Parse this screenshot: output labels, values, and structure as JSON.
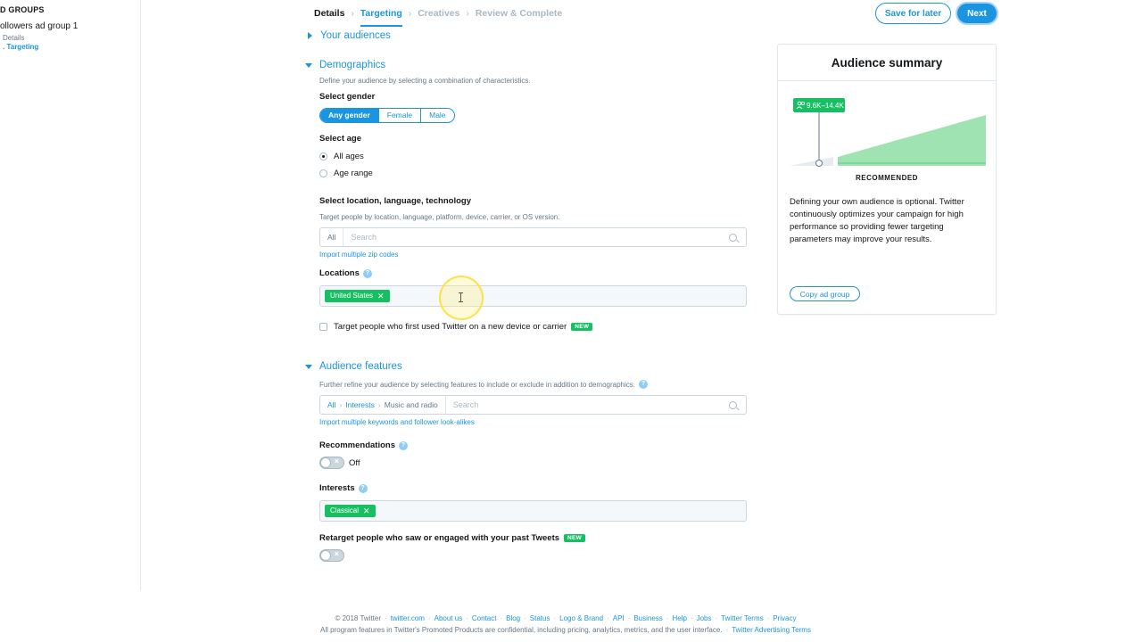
{
  "sidebar": {
    "heading": "D GROUPS",
    "group_name": "ollowers ad group 1",
    "step_details": "Details",
    "step_targeting": ". Targeting"
  },
  "steps": [
    {
      "label": "Details",
      "state": "done"
    },
    {
      "label": "Targeting",
      "state": "active"
    },
    {
      "label": "Creatives",
      "state": "pending"
    },
    {
      "label": "Review & Complete",
      "state": "pending"
    }
  ],
  "header": {
    "save_label": "Save for later",
    "next_label": "Next"
  },
  "your_audiences": {
    "title": "Your audiences"
  },
  "demographics": {
    "title": "Demographics",
    "hint": "Define your audience by selecting a combination of characteristics.",
    "gender_label": "Select gender",
    "gender_options": [
      "Any gender",
      "Female",
      "Male"
    ],
    "gender_selected": "Any gender",
    "age_label": "Select age",
    "age_all": "All ages",
    "age_range": "Age range",
    "loc_label": "Select location, language, technology",
    "loc_hint": "Target people by location, language, platform, device, carrier, or OS version.",
    "loc_prefix": "All",
    "loc_placeholder": "Search",
    "import_zip": "Import multiple zip codes",
    "locations_label": "Locations",
    "location_tag": "United States",
    "new_device_text": "Target people who first used Twitter on a new device or carrier",
    "new_badge": "NEW"
  },
  "audience_features": {
    "title": "Audience features",
    "hint": "Further refine your audience by selecting features to include or exclude in addition to demographics.",
    "crumb_all": "All",
    "crumb_interests": "Interests",
    "crumb_current": "Music and radio",
    "placeholder": "Search",
    "import_link": "Import multiple keywords and follower look-alikes",
    "recommendations_label": "Recommendations",
    "recommendations_state": "Off",
    "toggle_x": "×",
    "interests_label": "Interests",
    "interest_tag": "Classical",
    "retarget_label": "Retarget people who saw or engaged with your past Tweets",
    "new_badge": "NEW"
  },
  "summary": {
    "title": "Audience summary",
    "range": "9.6K–14.4K",
    "recommended": "RECOMMENDED",
    "text": "Defining your own audience is optional. Twitter continuously optimizes your campaign for high performance so providing fewer targeting parameters may improve your results.",
    "copy_label": "Copy ad group"
  },
  "footer": {
    "copyright": "© 2018 Twitter",
    "links": [
      "twitter.com",
      "About us",
      "Contact",
      "Blog",
      "Status",
      "Logo & Brand",
      "API",
      "Business",
      "Help",
      "Jobs",
      "Twitter Terms",
      "Privacy"
    ],
    "notice": "All program features in Twitter's Promoted Products are confidential, including pricing, analytics, metrics, and the user interface.",
    "ad_terms": "Twitter Advertising Terms"
  },
  "colors": {
    "accent": "#1b95e0",
    "green": "#17bf63",
    "chart_fill": "#9fe3b3"
  },
  "help_glyph": "?",
  "close_glyph": "✕",
  "chevron_glyph": "›"
}
